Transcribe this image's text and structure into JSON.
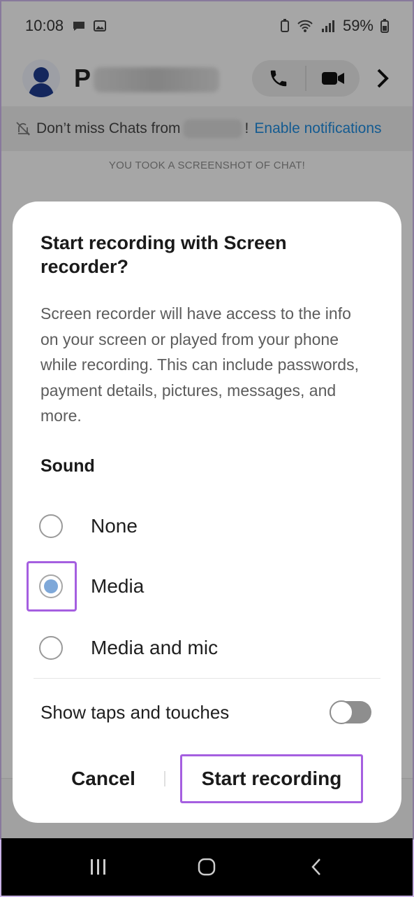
{
  "status_bar": {
    "time": "10:08",
    "battery": "59%"
  },
  "chat": {
    "contact_initial": "P",
    "notification": {
      "prefix": "Don’t miss Chats from",
      "suffix": "!",
      "link": "Enable notifications"
    },
    "screenshot_notice": "YOU TOOK A SCREENSHOT OF CHAT!"
  },
  "dialog": {
    "title": "Start recording with Screen recorder?",
    "body": "Screen recorder will have access to the info on your screen or played from your phone while recording. This can include passwords, payment details, pictures, messages, and more.",
    "sound_heading": "Sound",
    "sound_options": [
      {
        "label": "None",
        "selected": false
      },
      {
        "label": "Media",
        "selected": true
      },
      {
        "label": "Media and mic",
        "selected": false
      }
    ],
    "show_taps_label": "Show taps and touches",
    "show_taps_enabled": false,
    "cancel_label": "Cancel",
    "start_label": "Start recording"
  },
  "colors": {
    "accent_highlight": "#a55fe0",
    "link_blue": "#1e86d6",
    "radio_selected": "#7ea8d9"
  },
  "icons": {
    "call": "phone-icon",
    "video": "video-camera-icon",
    "next": "chevron-right-icon",
    "muted_bell": "bell-off-icon",
    "nav_recents": "recents-icon",
    "nav_home": "home-icon",
    "nav_back": "back-icon"
  }
}
